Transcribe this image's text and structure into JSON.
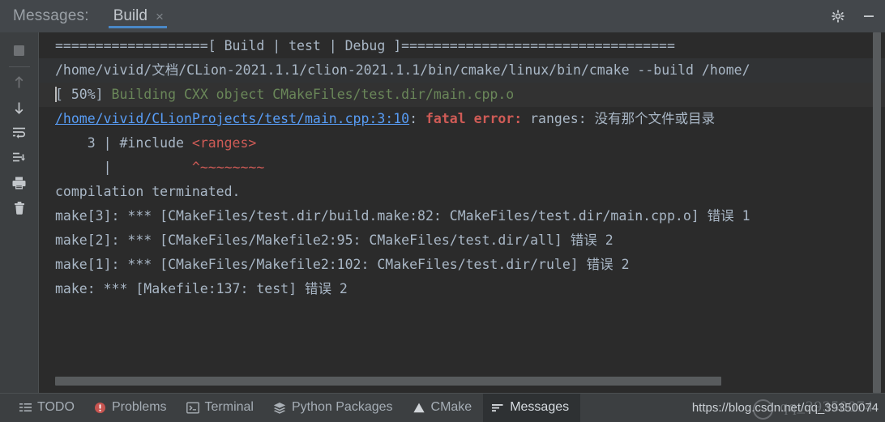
{
  "window": {
    "tool_label": "Messages:",
    "tab_title": "Build",
    "tab_close": "×",
    "settings_icon": "gear-icon",
    "minimize_icon": "minimize-icon"
  },
  "left_toolbar": {
    "items": [
      {
        "name": "stop-button",
        "label": "Stop"
      },
      {
        "name": "up-arrow-button",
        "label": "Previous occurrence"
      },
      {
        "name": "down-arrow-button",
        "label": "Next occurrence"
      },
      {
        "name": "soft-wrap-button",
        "label": "Soft-Wrap"
      },
      {
        "name": "scroll-to-end-button",
        "label": "Scroll to end"
      },
      {
        "name": "print-button",
        "label": "Print"
      },
      {
        "name": "clear-all-button",
        "label": "Clear All"
      }
    ]
  },
  "console": {
    "lines": [
      {
        "id": "line-banner",
        "style": "plain",
        "segments": [
          {
            "text": "===================[ Build | test | Debug ]==================================",
            "color": "grey"
          }
        ]
      },
      {
        "id": "line-cmake-cmd",
        "style": "alt",
        "segments": [
          {
            "text": "/home/vivid/文档/CLion-2021.1.1/clion-2021.1.1/bin/cmake/linux/bin/cmake --build /home/",
            "color": "grey"
          }
        ]
      },
      {
        "id": "line-progress-50",
        "style": "hl",
        "caret": true,
        "segments": [
          {
            "text": "[ 50%] ",
            "color": "grey"
          },
          {
            "text": "Building CXX object CMakeFiles/test.dir/main.cpp.o",
            "color": "green"
          }
        ]
      },
      {
        "id": "line-fatal-error",
        "style": "plain",
        "segments": [
          {
            "text": "/home/vivid/CLionProjects/test/main.cpp:3:10",
            "color": "link"
          },
          {
            "text": ": ",
            "color": "grey"
          },
          {
            "text": "fatal error:",
            "color": "redbold"
          },
          {
            "text": " ranges: 没有那个文件或目录",
            "color": "grey"
          }
        ]
      },
      {
        "id": "line-source-3",
        "style": "plain",
        "segments": [
          {
            "text": "    3 | #include ",
            "color": "grey"
          },
          {
            "text": "<ranges>",
            "color": "red"
          }
        ]
      },
      {
        "id": "line-caret-marker",
        "style": "plain",
        "segments": [
          {
            "text": "      |          ",
            "color": "grey"
          },
          {
            "text": "^~~~~~~~~",
            "color": "red"
          }
        ]
      },
      {
        "id": "line-compilation-terminated",
        "style": "plain",
        "segments": [
          {
            "text": "compilation terminated.",
            "color": "grey"
          }
        ]
      },
      {
        "id": "line-make-3",
        "style": "plain",
        "segments": [
          {
            "text": "make[3]: *** [CMakeFiles/test.dir/build.make:82: CMakeFiles/test.dir/main.cpp.o] 错误 1",
            "color": "grey"
          }
        ]
      },
      {
        "id": "line-make-2",
        "style": "plain",
        "segments": [
          {
            "text": "make[2]: *** [CMakeFiles/Makefile2:95: CMakeFiles/test.dir/all] 错误 2",
            "color": "grey"
          }
        ]
      },
      {
        "id": "line-make-1",
        "style": "plain",
        "segments": [
          {
            "text": "make[1]: *** [CMakeFiles/Makefile2:102: CMakeFiles/test.dir/rule] 错误 2",
            "color": "grey"
          }
        ]
      },
      {
        "id": "line-make",
        "style": "plain",
        "segments": [
          {
            "text": "make: *** [Makefile:137: test] 错误 2",
            "color": "grey"
          }
        ]
      }
    ]
  },
  "statusbar": {
    "items": [
      {
        "id": "todo",
        "label": "TODO",
        "icon": "list-icon",
        "active": false
      },
      {
        "id": "problems",
        "label": "Problems",
        "icon": "error-icon",
        "active": false
      },
      {
        "id": "terminal",
        "label": "Terminal",
        "icon": "terminal-icon",
        "active": false
      },
      {
        "id": "python-packages",
        "label": "Python Packages",
        "icon": "layers-icon",
        "active": false
      },
      {
        "id": "cmake",
        "label": "CMake",
        "icon": "triangle-icon",
        "active": false
      },
      {
        "id": "messages",
        "label": "Messages",
        "icon": "messages-icon",
        "active": true
      }
    ],
    "watermark": "https://blog.csdn.net/qq_39350074",
    "watermark_logo": "qq_39350074"
  },
  "colors": {
    "accent": "#4a88c7",
    "console_bg": "#2b2b2b",
    "panel_bg": "#3c3f41",
    "text": "#a9b7c6",
    "green": "#6a8759",
    "red": "#cf5b56",
    "link": "#589df6"
  }
}
